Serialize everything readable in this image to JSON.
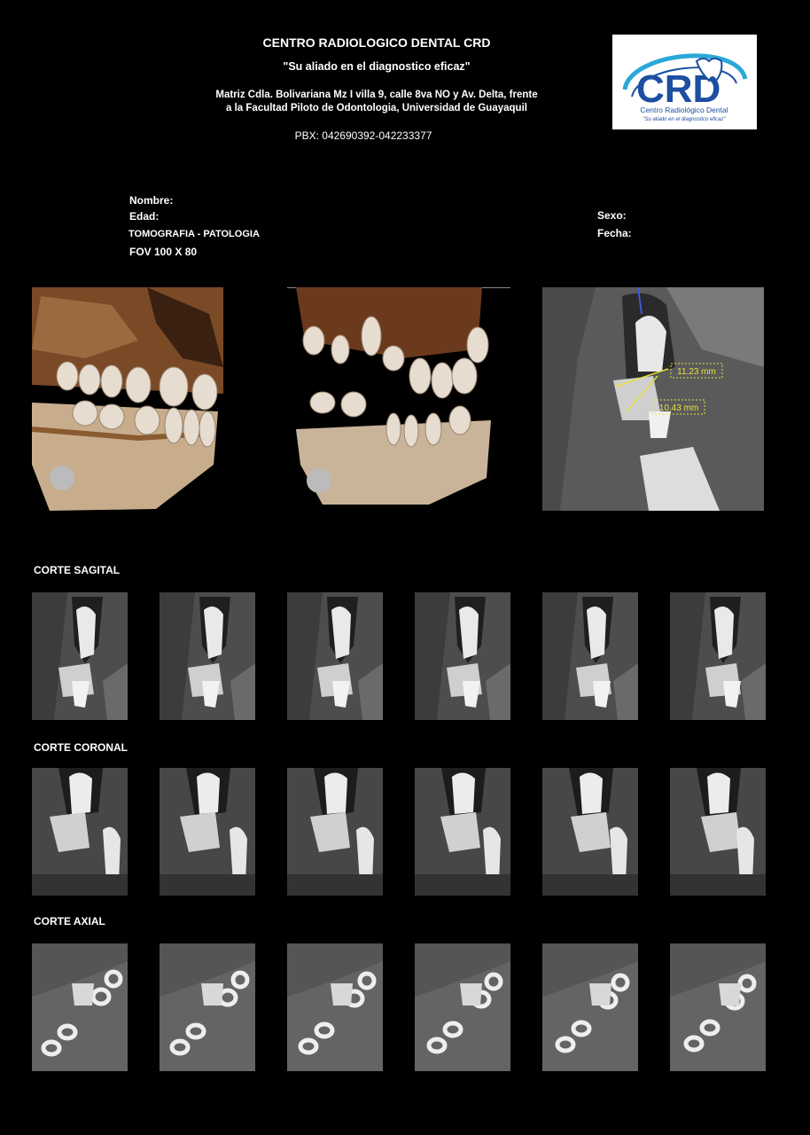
{
  "header": {
    "title": "CENTRO RADIOLOGICO DENTAL CRD",
    "slogan": "\"Su aliado en el diagnostico eficaz\"",
    "address_line1": "Matriz Cdla. Bolivariana Mz I villa 9, calle 8va NO y Av. Delta, frente",
    "address_line2": "a la Facultad Piloto de Odontologia, Universidad de Guayaquil",
    "phone_label": "PBX:",
    "phone": "042690392-042233377"
  },
  "logo": {
    "mark": "CRD",
    "name": "Centro Radiológico Dental",
    "tagline": "\"Su aliado en el diagnostico eficaz\""
  },
  "patient": {
    "name_label": "Nombre:",
    "age_label": "Edad:",
    "study": "TOMOGRAFIA - PATOLOGIA",
    "fov": "FOV 100 X 80",
    "sex_label": "Sexo:",
    "date_label": "Fecha:"
  },
  "measurements": {
    "m1": "11.23 mm",
    "m2": "10.43 mm"
  },
  "sections": {
    "sagital": "CORTE SAGITAL",
    "coronal": "CORTE CORONAL",
    "axial": "CORTE AXIAL"
  },
  "colors": {
    "background": "#000000",
    "bone": "#c9b49a",
    "brown": "#6b3a1d",
    "measure": "#e8e040",
    "logo_blue": "#1c4fa0",
    "logo_cyan": "#2aa8d8"
  }
}
